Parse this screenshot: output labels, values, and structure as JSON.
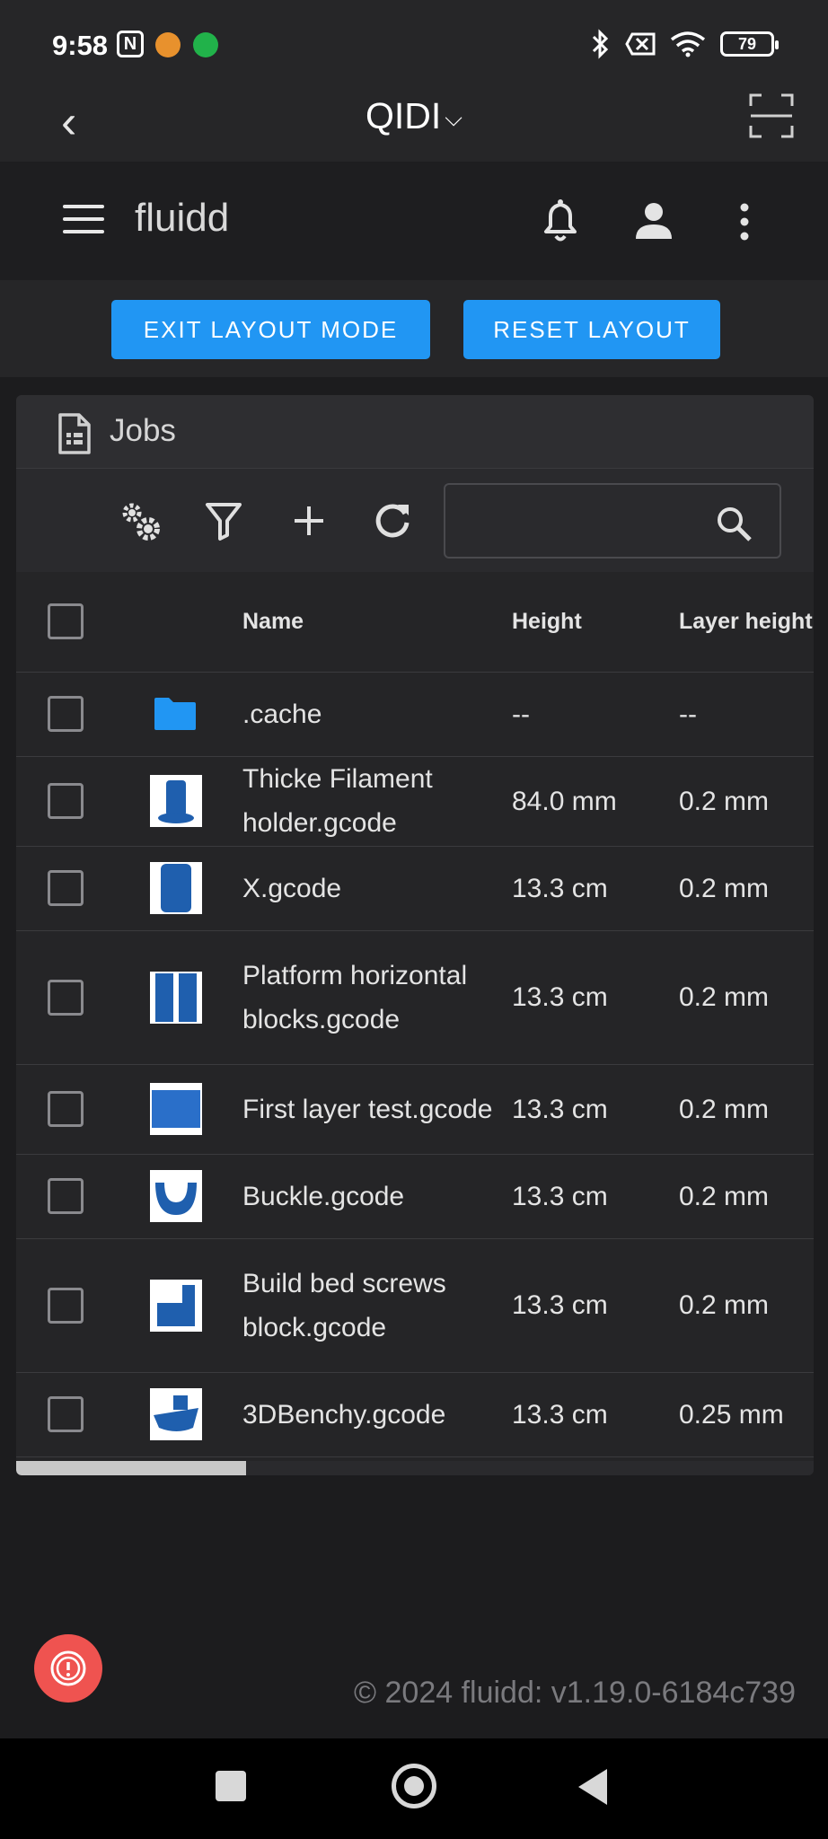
{
  "status_bar": {
    "time": "9:58",
    "nfc_glyph": "N",
    "battery": "79",
    "icons": [
      "nfc-icon",
      "app-notification-icon",
      "shield-app-icon",
      "bluetooth-icon",
      "no-sim-icon",
      "wifi-icon",
      "battery-icon"
    ]
  },
  "app_header": {
    "title": "QIDI",
    "chevron": "⌵",
    "back_icon": "‹"
  },
  "toolbar": {
    "brand": "fluidd"
  },
  "layout_buttons": {
    "exit_label": "EXIT LAYOUT MODE",
    "reset_label": "RESET LAYOUT"
  },
  "jobs": {
    "title": "Jobs",
    "search_value": "",
    "columns": {
      "name": "Name",
      "height": "Height",
      "layer_height": "Layer height"
    },
    "rows": [
      {
        "name": ".cache",
        "height": "--",
        "layer_height": "--",
        "type": "folder"
      },
      {
        "name": "Thicke Filament holder.gcode",
        "height": "84.0 mm",
        "layer_height": "0.2 mm",
        "type": "file"
      },
      {
        "name": "X.gcode",
        "height": "13.3 cm",
        "layer_height": "0.2 mm",
        "type": "file"
      },
      {
        "name": "Platform horizontal blocks.gcode",
        "height": "13.3 cm",
        "layer_height": "0.2 mm",
        "type": "file"
      },
      {
        "name": "First layer test.gcode",
        "height": "13.3 cm",
        "layer_height": "0.2 mm",
        "type": "file"
      },
      {
        "name": "Buckle.gcode",
        "height": "13.3 cm",
        "layer_height": "0.2 mm",
        "type": "file"
      },
      {
        "name": "Build bed screws block.gcode",
        "height": "13.3 cm",
        "layer_height": "0.2 mm",
        "type": "file"
      },
      {
        "name": "3DBenchy.gcode",
        "height": "13.3 cm",
        "layer_height": "0.25 mm",
        "type": "file"
      }
    ]
  },
  "footer": {
    "text": "© 2024 fluidd: v1.19.0-6184c739"
  },
  "colors": {
    "accent": "#2196f3",
    "emergency": "#ef5350",
    "thumbnail_model": "#1f5fae"
  }
}
